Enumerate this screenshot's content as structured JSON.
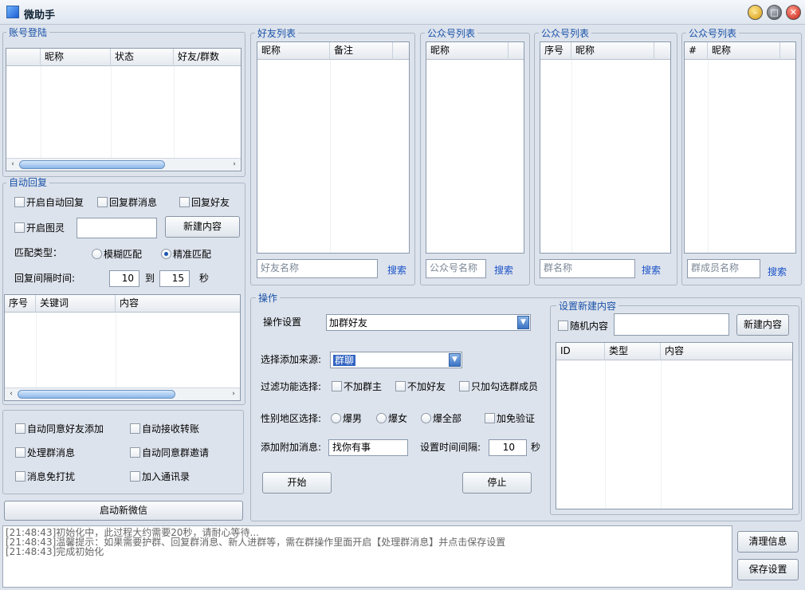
{
  "window": {
    "title": "微助手",
    "minimize_glyph": "–",
    "restore_glyph": "□",
    "close_glyph": "✕"
  },
  "login": {
    "group_title": "账号登陆",
    "columns": [
      "",
      "昵称",
      "状态",
      "好友/群数"
    ],
    "scroll_left": "‹",
    "scroll_right": "›"
  },
  "auto_reply": {
    "group_title": "自动回复",
    "enable_auto_reply": "开启自动回复",
    "reply_group_msg": "回复群消息",
    "reply_friend": "回复好友",
    "enable_tuling": "开启图灵",
    "tuling_value": "",
    "new_content_button": "新建内容",
    "match_type_label": "匹配类型：",
    "match_fuzzy": "模糊匹配",
    "match_exact": "精准匹配",
    "interval_label": "回复间隔时间:",
    "interval_from": "10",
    "to_label": "到",
    "interval_to": "15",
    "seconds_label": "秒",
    "columns": [
      "序号",
      "关键词",
      "内容"
    ],
    "scroll_left": "‹",
    "scroll_right": "›"
  },
  "options": {
    "auto_accept_friend": "自动同意好友添加",
    "auto_receive_transfer": "自动接收转账",
    "handle_group_msg": "处理群消息",
    "auto_accept_group_invite": "自动同意群邀请",
    "mute_messages": "消息免打扰",
    "add_to_contacts": "加入通讯录"
  },
  "start_new_wechat": "启动新微信",
  "friend_list": {
    "group_title": "好友列表",
    "columns": [
      "昵称",
      "备注",
      ""
    ],
    "search_placeholder": "好友名称",
    "search_link": "搜索"
  },
  "official_list_1": {
    "group_title": "公众号列表",
    "columns": [
      "昵称",
      ""
    ],
    "search_placeholder": "公众号名称",
    "search_link": "搜索"
  },
  "official_list_2": {
    "group_title": "公众号列表",
    "columns": [
      "序号",
      "昵称",
      ""
    ],
    "search_placeholder": "群名称",
    "search_link": "搜索"
  },
  "official_list_3": {
    "group_title": "公众号列表",
    "columns": [
      "#",
      "昵称",
      ""
    ],
    "search_placeholder": "群成员名称",
    "search_link": "搜索"
  },
  "operation": {
    "group_title": "操作",
    "op_settings_label": "操作设置",
    "op_settings_value": "加群好友",
    "source_label": "选择添加来源:",
    "source_value": "群聊",
    "filter_label": "过滤功能选择:",
    "no_group_owner": "不加群主",
    "no_friends": "不加好友",
    "only_checked_members": "只加勾选群成员",
    "gender_label": "性别地区选择:",
    "male": "爆男",
    "female": "爆女",
    "all": "爆全部",
    "no_verify": "加免验证",
    "extra_msg_label": "添加附加消息:",
    "extra_msg_value": "找你有事",
    "interval_label": "设置时间间隔:",
    "interval_value": "10",
    "seconds_label": "秒",
    "start_button": "开始",
    "stop_button": "停止",
    "dropdown_glyph": "▼"
  },
  "new_content": {
    "group_title": "设置新建内容",
    "random_content": "随机内容",
    "content_value": "",
    "new_button": "新建内容",
    "columns": [
      "ID",
      "类型",
      "内容"
    ]
  },
  "log": {
    "lines": [
      "[21:48:43]初始化中，此过程大约需要20秒，请耐心等待...",
      "[21:48:43]温馨提示：如果需要护群、回复群消息、新人进群等，需在群操作里面开启【处理群消息】并点击保存设置",
      "[21:48:43]完成初始化"
    ]
  },
  "clear_button": "清理信息",
  "save_button": "保存设置"
}
